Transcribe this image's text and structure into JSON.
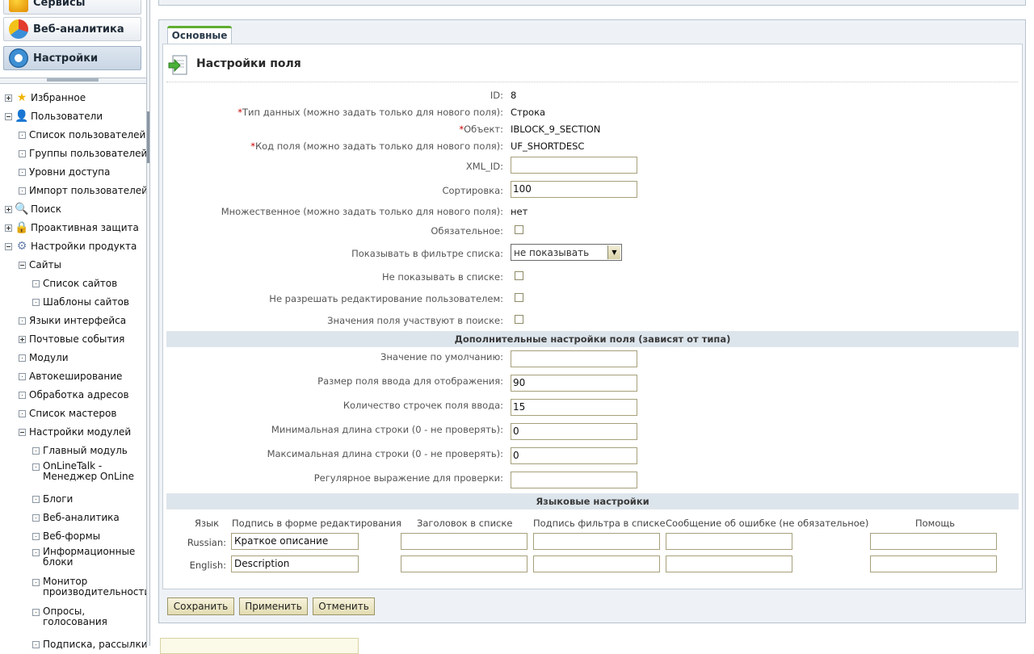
{
  "modules": [
    {
      "label": "Сервисы",
      "icon": "services-icon"
    },
    {
      "label": "Веб-аналитика",
      "icon": "analytics-icon"
    },
    {
      "label": "Настройки",
      "icon": "settings-gear-icon",
      "active": true
    }
  ],
  "tree": [
    {
      "label": "Избранное",
      "toggle": "plus",
      "icon": "star-icon"
    },
    {
      "label": "Пользователи",
      "toggle": "minus",
      "icon": "users-icon"
    },
    {
      "label": "Список пользователей",
      "toggle": "dot"
    },
    {
      "label": "Группы пользователей",
      "toggle": "dot"
    },
    {
      "label": "Уровни доступа",
      "toggle": "dot"
    },
    {
      "label": "Импорт пользователей",
      "toggle": "dot"
    },
    {
      "label": "Поиск",
      "toggle": "plus",
      "icon": "search-icon"
    },
    {
      "label": "Проактивная защита",
      "toggle": "plus",
      "icon": "lock-icon"
    },
    {
      "label": "Настройки продукта",
      "toggle": "minus",
      "icon": "gear-icon"
    },
    {
      "label": "Сайты",
      "toggle": "minus"
    },
    {
      "label": "Список сайтов",
      "toggle": "dot"
    },
    {
      "label": "Шаблоны сайтов",
      "toggle": "dot"
    },
    {
      "label": "Языки интерфейса",
      "toggle": "dot"
    },
    {
      "label": "Почтовые события",
      "toggle": "plus"
    },
    {
      "label": "Модули",
      "toggle": "dot"
    },
    {
      "label": "Автокеширование",
      "toggle": "dot"
    },
    {
      "label": "Обработка адресов",
      "toggle": "dot"
    },
    {
      "label": "Список мастеров",
      "toggle": "dot"
    },
    {
      "label": "Настройки модулей",
      "toggle": "minus"
    },
    {
      "label": "Главный модуль",
      "toggle": "dot"
    },
    {
      "label": "OnLineTalk - Менеджер OnLine",
      "toggle": "dot"
    },
    {
      "label": "Блоги",
      "toggle": "dot"
    },
    {
      "label": "Веб-аналитика",
      "toggle": "dot"
    },
    {
      "label": "Веб-формы",
      "toggle": "dot"
    },
    {
      "label": "Информационные блоки",
      "toggle": "dot"
    },
    {
      "label": "Монитор производительности",
      "toggle": "dot"
    },
    {
      "label": "Опросы, голосования",
      "toggle": "dot"
    },
    {
      "label": "Подписка, рассылки",
      "toggle": "dot"
    }
  ],
  "tab": {
    "label": "Основные"
  },
  "page": {
    "title": "Настройки поля"
  },
  "fields": {
    "id": {
      "label": "ID:",
      "value": "8"
    },
    "type": {
      "label": "Тип данных (можно задать только для нового поля):",
      "value": "Строка"
    },
    "object": {
      "label": "Объект:",
      "value": "IBLOCK_9_SECTION"
    },
    "code": {
      "label": "Код поля (можно задать только для нового поля):",
      "value": "UF_SHORTDESC"
    },
    "xml_id": {
      "label": "XML_ID:",
      "value": ""
    },
    "sort": {
      "label": "Сортировка:",
      "value": "100"
    },
    "multiple": {
      "label": "Множественное (можно задать только для нового поля):",
      "value": "нет"
    },
    "mandatory": {
      "label": "Обязательное:"
    },
    "show_filter": {
      "label": "Показывать в фильтре списка:",
      "value": "не показывать"
    },
    "show_in_list": {
      "label": "Не показывать в списке:"
    },
    "edit_in_list": {
      "label": "Не разрешать редактирование пользователем:"
    },
    "is_searchable": {
      "label": "Значения поля участвуют в поиске:"
    }
  },
  "extra": {
    "title": "Дополнительные настройки поля (зависят от типа)",
    "default": {
      "label": "Значение по умолчанию:",
      "value": ""
    },
    "size": {
      "label": "Размер поля ввода для отображения:",
      "value": "90"
    },
    "rows": {
      "label": "Количество строчек поля ввода:",
      "value": "15"
    },
    "min_length": {
      "label": "Минимальная длина строки (0 - не проверять):",
      "value": "0"
    },
    "max_length": {
      "label": "Максимальная длина строки (0 - не проверять):",
      "value": "0"
    },
    "regexp": {
      "label": "Регулярное выражение для проверки:",
      "value": ""
    }
  },
  "lang": {
    "title": "Языковые настройки",
    "headers": [
      "Язык",
      "Подпись в форме редактирования",
      "Заголовок в списке",
      "Подпись фильтра в списке",
      "Сообщение об ошибке (не обязательное)",
      "Помощь"
    ],
    "rows": [
      {
        "lang": "Russian:",
        "edit_label": "Краткое описание"
      },
      {
        "lang": "English:",
        "edit_label": "Description"
      }
    ]
  },
  "buttons": {
    "save": "Сохранить",
    "apply": "Применить",
    "cancel": "Отменить"
  }
}
